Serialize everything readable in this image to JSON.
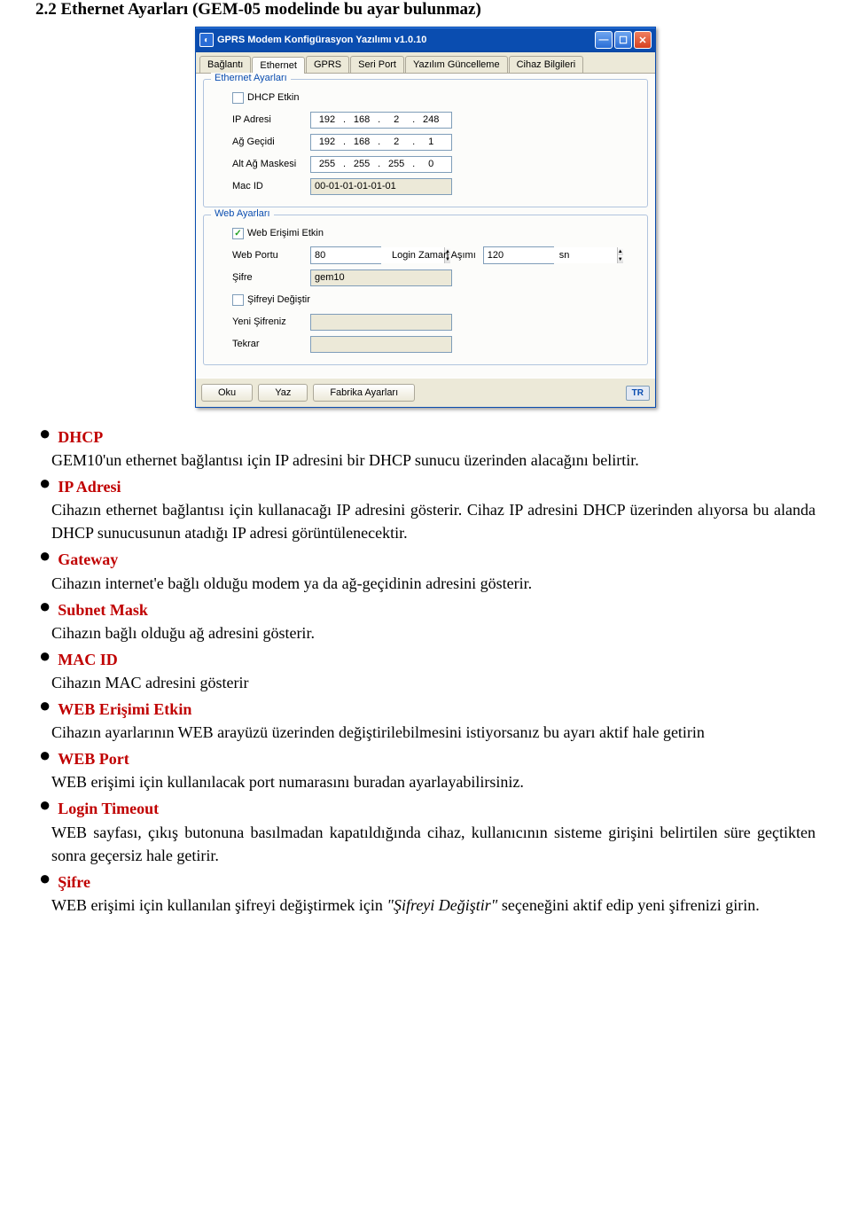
{
  "section_title": "2.2 Ethernet Ayarları (GEM-05 modelinde bu ayar bulunmaz)",
  "window": {
    "title": "GPRS Modem Konfigürasyon Yazılımı v1.0.10",
    "tabs": [
      "Bağlantı",
      "Ethernet",
      "GPRS",
      "Seri Port",
      "Yazılım Güncelleme",
      "Cihaz Bilgileri"
    ],
    "active_tab": 1,
    "ethernet": {
      "legend": "Ethernet Ayarları",
      "dhcp_label": "DHCP Etkin",
      "dhcp_checked": false,
      "ip_label": "IP Adresi",
      "ip": [
        "192",
        "168",
        "2",
        "248"
      ],
      "gw_label": "Ağ Geçidi",
      "gw": [
        "192",
        "168",
        "2",
        "1"
      ],
      "mask_label": "Alt Ağ Maskesi",
      "mask": [
        "255",
        "255",
        "255",
        "0"
      ],
      "mac_label": "Mac ID",
      "mac": "00-01-01-01-01-01"
    },
    "web": {
      "legend": "Web Ayarları",
      "enabled_label": "Web Erişimi Etkin",
      "enabled_checked": true,
      "port_label": "Web Portu",
      "port": "80",
      "timeout_label": "Login Zaman Aşımı",
      "timeout": "120",
      "timeout_unit": "sn",
      "pass_label": "Şifre",
      "pass": "gem10",
      "change_pass_label": "Şifreyi Değiştir",
      "change_pass_checked": false,
      "new_pass_label": "Yeni Şifreniz",
      "repeat_label": "Tekrar"
    },
    "buttons": {
      "read": "Oku",
      "write": "Yaz",
      "factory": "Fabrika Ayarları",
      "lang": "TR"
    }
  },
  "doc": {
    "dhcp": {
      "term": "DHCP",
      "desc": "GEM10'un ethernet bağlantısı için IP adresini bir DHCP sunucu üzerinden alacağını belirtir."
    },
    "ip": {
      "term": "IP Adresi",
      "desc": "Cihazın ethernet bağlantısı için kullanacağı IP adresini gösterir. Cihaz IP adresini DHCP üzerinden alıyorsa bu alanda DHCP sunucusunun atadığı IP adresi görüntülenecektir."
    },
    "gw": {
      "term": "Gateway",
      "desc": "Cihazın internet'e bağlı olduğu modem ya da ağ-geçidinin adresini gösterir."
    },
    "mask": {
      "term": "Subnet Mask",
      "desc": "Cihazın bağlı olduğu ağ adresini gösterir."
    },
    "mac": {
      "term": "MAC ID",
      "desc": "Cihazın MAC adresini gösterir"
    },
    "web_en": {
      "term": "WEB Erişimi Etkin",
      "desc": "Cihazın ayarlarının WEB arayüzü üzerinden değiştirilebilmesini istiyorsanız bu ayarı aktif hale getirin"
    },
    "web_port": {
      "term": "WEB Port",
      "desc": "WEB erişimi için kullanılacak port numarasını buradan ayarlayabilirsiniz."
    },
    "login_to": {
      "term": "Login Timeout",
      "desc": "WEB sayfası, çıkış butonuna basılmadan kapatıldığında cihaz, kullanıcının sisteme girişini belirtilen süre geçtikten sonra geçersiz hale getirir."
    },
    "sifre": {
      "term": "Şifre",
      "desc_pre": "WEB erişimi için kullanılan şifreyi değiştirmek için ",
      "desc_em": "\"Şifreyi Değiştir\"",
      "desc_post": " seçeneğini aktif edip yeni şifrenizi girin."
    }
  }
}
